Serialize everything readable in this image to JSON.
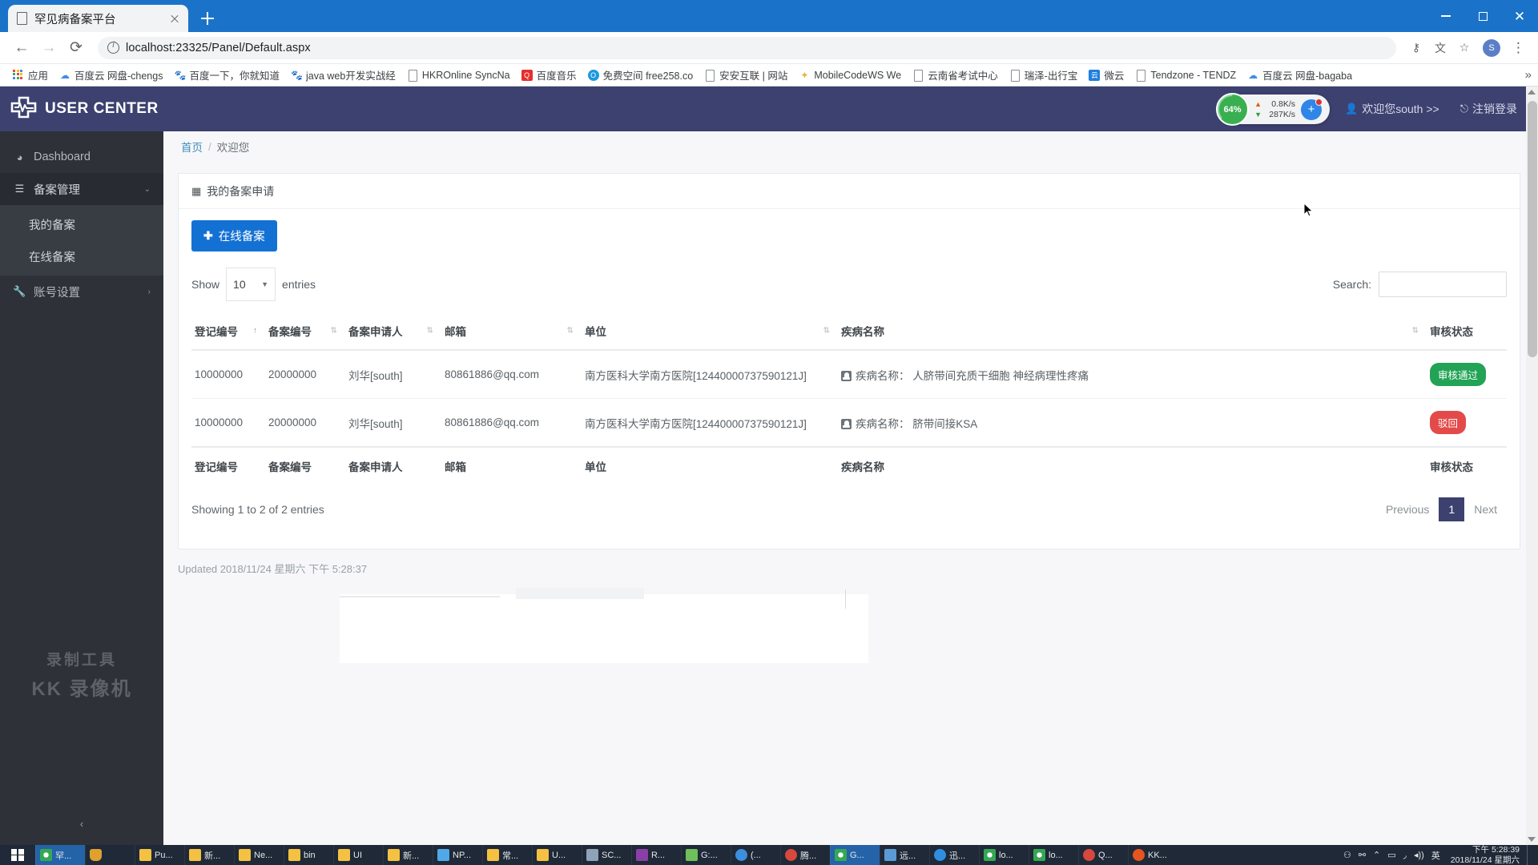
{
  "browser": {
    "tab": {
      "title": "罕见病备案平台",
      "favicon_icon": "document-icon",
      "close_icon": "close-icon"
    },
    "new_tab_icon": "plus-icon",
    "window_controls": {
      "minimize_icon": "minimize-icon",
      "maximize_icon": "maximize-icon",
      "close_icon": "close-icon"
    },
    "nav": {
      "back_icon": "arrow-left-icon",
      "forward_icon": "arrow-right-icon",
      "reload_icon": "reload-icon"
    },
    "url": {
      "security_icon": "info-circle-icon",
      "host": "localhost:23325",
      "path": "/Panel/Default.aspx",
      "full": "localhost:23325/Panel/Default.aspx"
    },
    "omnibox_icons": [
      "key-icon",
      "translate-icon",
      "star-icon"
    ],
    "profile_avatar": "S",
    "menu_icon": "kebab-menu-icon",
    "bookmarks": [
      {
        "label": "应用",
        "icon": "apps-grid-icon"
      },
      {
        "label": "百度云 网盘-chengs",
        "icon": "baidu-cloud-icon"
      },
      {
        "label": "百度一下，你就知道",
        "icon": "baidu-icon"
      },
      {
        "label": "java web开发实战经",
        "icon": "baidu-icon"
      },
      {
        "label": "HKROnline SyncNa",
        "icon": "document-icon"
      },
      {
        "label": "百度音乐",
        "icon": "qq-music-icon"
      },
      {
        "label": "免费空间 free258.co",
        "icon": "blue-circle-icon"
      },
      {
        "label": "安安互联 | 网站",
        "icon": "document-icon"
      },
      {
        "label": "MobileCodeWS We",
        "icon": "star-badge-icon"
      },
      {
        "label": "云南省考试中心",
        "icon": "document-icon"
      },
      {
        "label": "瑞泽-出行宝",
        "icon": "document-icon"
      },
      {
        "label": "微云",
        "icon": "weiyun-icon"
      },
      {
        "label": "Tendzone - TENDZ",
        "icon": "document-icon"
      },
      {
        "label": "百度云 网盘-bagaba",
        "icon": "baidu-cloud-icon"
      }
    ],
    "bookmarks_overflow_icon": "chevron-double-right-icon"
  },
  "app": {
    "brand": {
      "logo_icon": "medical-cross-ecg-icon",
      "name_bold": "USER",
      "name_light": "CENTER"
    },
    "topbar": {
      "user_icon": "user-icon",
      "user_label": "欢迎您south >>",
      "logout_icon": "logout-icon",
      "logout_label": "注销登录"
    },
    "netmonitor": {
      "cpu_percent": "64%",
      "cpu_value": 64,
      "upload_icon": "arrow-up-icon",
      "upload_rate": "0.8K/s",
      "download_icon": "arrow-down-icon",
      "download_rate": "287K/s",
      "badge_icon": "plus-circle-icon"
    },
    "sidebar": {
      "items": [
        {
          "label": "Dashboard",
          "icon": "dashboard-icon",
          "type": "link"
        },
        {
          "label": "备案管理",
          "icon": "list-icon",
          "type": "group",
          "chevron": "chevron-down-icon",
          "expanded": true
        },
        {
          "label": "账号设置",
          "icon": "wrench-icon",
          "type": "group",
          "chevron": "chevron-right-icon",
          "expanded": false
        }
      ],
      "submenu": [
        {
          "label": "我的备案"
        },
        {
          "label": "在线备案"
        }
      ],
      "collapse_icon": "chevron-left-icon",
      "watermark_line1": "录制工具",
      "watermark_line2": "KK 录像机"
    },
    "breadcrumb": {
      "home": "首页",
      "separator": "/",
      "current": "欢迎您"
    },
    "panel": {
      "header_icon": "table-icon",
      "header_title": "我的备案申请",
      "add_button": {
        "icon": "plus-icon",
        "label": "在线备案"
      }
    },
    "datatable": {
      "show_label": "Show",
      "entries_label": "entries",
      "page_length": "10",
      "length_caret_icon": "caret-down-icon",
      "search_label": "Search:",
      "search_value": "",
      "search_placeholder": "",
      "columns": [
        {
          "key": "reg_no",
          "label": "登记编号",
          "sort": "asc",
          "sort_icon": "sort-asc-icon"
        },
        {
          "key": "record_no",
          "label": "备案编号",
          "sort": "none",
          "sort_icon": "sort-icon"
        },
        {
          "key": "applicant",
          "label": "备案申请人",
          "sort": "none",
          "sort_icon": "sort-icon"
        },
        {
          "key": "email",
          "label": "邮箱",
          "sort": "none",
          "sort_icon": "sort-icon"
        },
        {
          "key": "unit",
          "label": "单位",
          "sort": "none",
          "sort_icon": "sort-icon"
        },
        {
          "key": "disease",
          "label": "疾病名称",
          "sort": "none",
          "sort_icon": "sort-icon"
        },
        {
          "key": "status",
          "label": "审核状态",
          "sort": "none",
          "sort_icon": "sort-icon"
        }
      ],
      "disease_prefix": "疾病名称：",
      "disease_icon": "file-badge-icon",
      "rows": [
        {
          "reg_no": "10000000",
          "record_no": "20000000",
          "applicant": "刘华[south]",
          "email": "80861886@qq.com",
          "unit": "南方医科大学南方医院[12440000737590121J]",
          "disease": "人脐带间充质干细胞 神经病理性疼痛",
          "status_label": "审核通过",
          "status_type": "pass"
        },
        {
          "reg_no": "10000000",
          "record_no": "20000000",
          "applicant": "刘华[south]",
          "email": "80861886@qq.com",
          "unit": "南方医科大学南方医院[12440000737590121J]",
          "disease": "脐带间接KSA",
          "status_label": "驳回",
          "status_type": "reject"
        }
      ],
      "info_text": "Showing 1 to 2 of 2 entries",
      "pagination": {
        "previous": "Previous",
        "pages": [
          "1"
        ],
        "current_page": "1",
        "next": "Next"
      }
    },
    "updated_text": "Updated 2018/11/24 星期六 下午 5:28:37"
  },
  "taskbar": {
    "start_icon": "windows-logo-icon",
    "items": [
      {
        "label": "罕...",
        "icon": "chrome-icon",
        "active": true
      },
      {
        "label": "",
        "icon": "shield-icon",
        "active": false
      },
      {
        "label": "Pu...",
        "icon": "folder-icon",
        "active": false
      },
      {
        "label": "新...",
        "icon": "folder-icon",
        "active": false
      },
      {
        "label": "Ne...",
        "icon": "folder-icon",
        "active": false
      },
      {
        "label": "bin",
        "icon": "folder-icon",
        "active": false
      },
      {
        "label": "UI",
        "icon": "folder-icon",
        "active": false
      },
      {
        "label": "新...",
        "icon": "folder-icon",
        "active": false
      },
      {
        "label": "NP...",
        "icon": "notepadpp-icon",
        "active": false
      },
      {
        "label": "常...",
        "icon": "folder-icon",
        "active": false
      },
      {
        "label": "U...",
        "icon": "folder-icon",
        "active": false
      },
      {
        "label": "SC...",
        "icon": "tools-icon",
        "active": false
      },
      {
        "label": "R...",
        "icon": "visualstudio-icon",
        "active": false
      },
      {
        "label": "G:...",
        "icon": "drive-icon",
        "active": false
      },
      {
        "label": "(...",
        "icon": "browser-icon",
        "active": false
      },
      {
        "label": "腾...",
        "icon": "qq-icon",
        "active": false
      },
      {
        "label": "G...",
        "icon": "chrome-icon",
        "active": true
      },
      {
        "label": "远...",
        "icon": "remote-icon",
        "active": false
      },
      {
        "label": "迅...",
        "icon": "thunder-icon",
        "active": false
      },
      {
        "label": "lo...",
        "icon": "chrome-icon",
        "active": false
      },
      {
        "label": "lo...",
        "icon": "chrome-icon",
        "active": false
      },
      {
        "label": "Q...",
        "icon": "qq-icon",
        "active": false
      },
      {
        "label": "KK...",
        "icon": "kk-icon",
        "active": false
      }
    ],
    "tray": {
      "icons": [
        "person-icon",
        "plug-icon",
        "chevron-up-icon",
        "battery-icon",
        "wifi-icon",
        "volume-icon"
      ],
      "ime": "英",
      "time": "下午 5:28:39",
      "date": "2018/11/24 星期六"
    }
  }
}
